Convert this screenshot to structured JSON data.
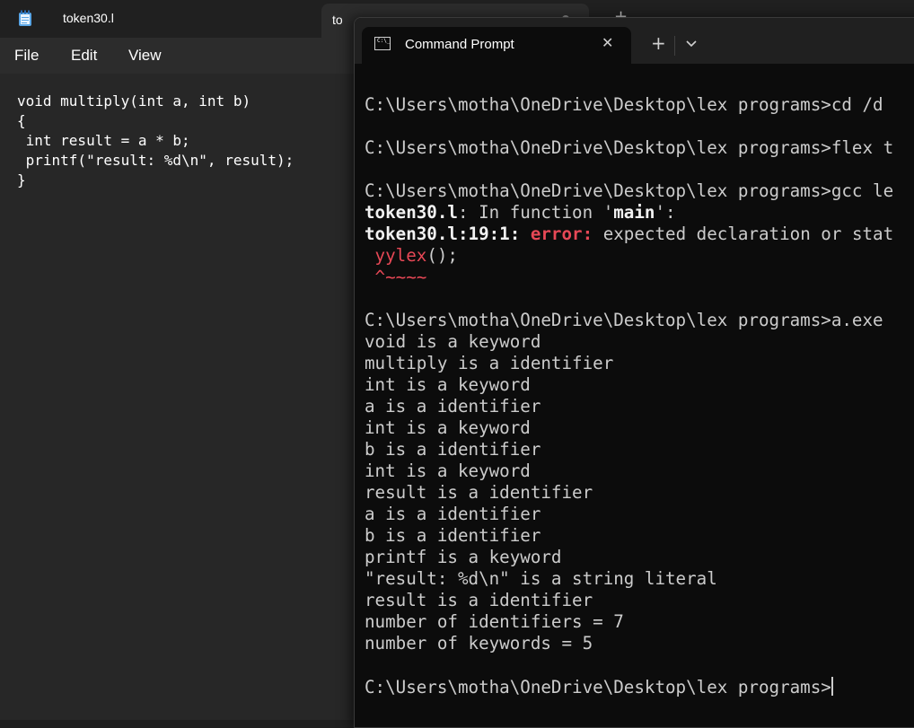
{
  "notepad": {
    "tab_title": "token30.l",
    "second_tab_title": "to",
    "new_tab_glyph": "+",
    "menu": {
      "file": "File",
      "edit": "Edit",
      "view": "View"
    },
    "code_lines": [
      "void multiply(int a, int b)",
      "{",
      " int result = a * b;",
      " printf(\"result: %d\\n\", result);",
      "}"
    ],
    "icon": "notepad-icon"
  },
  "cmd": {
    "tab_title": "Command Prompt",
    "icon": "cmd-icon",
    "icon_glyph": "C:\\_",
    "close_glyph": "✕",
    "new_tab_glyph": "+",
    "lines": {
      "l1": "C:\\Users\\motha\\OneDrive\\Desktop\\lex programs>cd /d ",
      "l2": "C:\\Users\\motha\\OneDrive\\Desktop\\lex programs>flex t",
      "l3": "C:\\Users\\motha\\OneDrive\\Desktop\\lex programs>gcc le",
      "l4_file": "token30.l",
      "l4_mid": ": In function '",
      "l4_main": "main",
      "l4_end": "':",
      "l5_loc": "token30.l:19:1:",
      "l5_error": " error:",
      "l5_msg": " expected declaration or stat",
      "l6_code": " yylex",
      "l6_rest": "();",
      "l7_caret": " ^~~~~",
      "l8": "C:\\Users\\motha\\OneDrive\\Desktop\\lex programs>a.exe ",
      "out": [
        "void is a keyword",
        "multiply is a identifier",
        "int is a keyword",
        "a is a identifier",
        "int is a keyword",
        "b is a identifier",
        "int is a keyword",
        "result is a identifier",
        "a is a identifier",
        "b is a identifier",
        "printf is a keyword",
        "\"result: %d\\n\" is a string literal",
        "result is a identifier",
        "number of identifiers = 7",
        "number of keywords = 5"
      ],
      "prompt": "C:\\Users\\motha\\OneDrive\\Desktop\\lex programs>"
    }
  },
  "colors": {
    "terminal_bg": "#0c0c0c",
    "terminal_text": "#cccccc",
    "error_red": "#e74856",
    "notepad_bg": "#272727"
  }
}
